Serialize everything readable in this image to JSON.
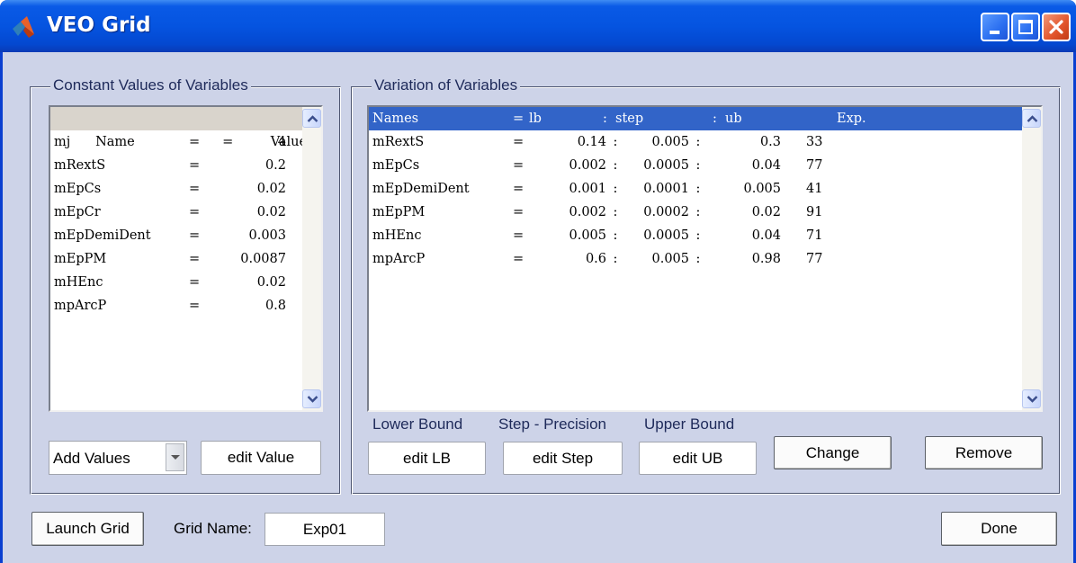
{
  "window": {
    "title": "VEO Grid",
    "buttons": [
      "minimize",
      "maximize",
      "close"
    ]
  },
  "constants_panel": {
    "title": "Constant Values of Variables",
    "header": {
      "name": "Name",
      "eq": "=",
      "value": "Value"
    },
    "rows": [
      {
        "name": "mj",
        "eq": "=",
        "value": "4"
      },
      {
        "name": "mRextS",
        "eq": "=",
        "value": "0.2"
      },
      {
        "name": "mEpCs",
        "eq": "=",
        "value": "0.02"
      },
      {
        "name": "mEpCr",
        "eq": "=",
        "value": "0.02"
      },
      {
        "name": "mEpDemiDent",
        "eq": "=",
        "value": "0.003"
      },
      {
        "name": "mEpPM",
        "eq": "=",
        "value": "0.0087"
      },
      {
        "name": "mHEnc",
        "eq": "=",
        "value": "0.02"
      },
      {
        "name": "mpArcP",
        "eq": "=",
        "value": "0.8"
      }
    ],
    "add_values_select": "Add Values",
    "edit_value_button": "edit Value"
  },
  "variation_panel": {
    "title": "Variation of Variables",
    "header": {
      "names": "Names",
      "eq": "=",
      "lb": "lb",
      "sep1": ":",
      "step": "step",
      "sep2": ":",
      "ub": "ub",
      "exp": "Exp."
    },
    "rows": [
      {
        "names": "mRextS",
        "eq": "=",
        "lb": "0.14",
        "sep1": ":",
        "step": "0.005",
        "sep2": ":",
        "ub": "0.3",
        "exp": "33"
      },
      {
        "names": "mEpCs",
        "eq": "=",
        "lb": "0.002",
        "sep1": ":",
        "step": "0.0005",
        "sep2": ":",
        "ub": "0.04",
        "exp": "77"
      },
      {
        "names": "mEpDemiDent",
        "eq": "=",
        "lb": "0.001",
        "sep1": ":",
        "step": "0.0001",
        "sep2": ":",
        "ub": "0.005",
        "exp": "41"
      },
      {
        "names": "mEpPM",
        "eq": "=",
        "lb": "0.002",
        "sep1": ":",
        "step": "0.0002",
        "sep2": ":",
        "ub": "0.02",
        "exp": "91"
      },
      {
        "names": "mHEnc",
        "eq": "=",
        "lb": "0.005",
        "sep1": ":",
        "step": "0.0005",
        "sep2": ":",
        "ub": "0.04",
        "exp": "71"
      },
      {
        "names": "mpArcP",
        "eq": "=",
        "lb": "0.6",
        "sep1": ":",
        "step": "0.005",
        "sep2": ":",
        "ub": "0.98",
        "exp": "77"
      }
    ],
    "lower_bound_label": "Lower Bound",
    "step_label": "Step - Precision",
    "upper_bound_label": "Upper Bound",
    "edit_lb_button": "edit LB",
    "edit_step_button": "edit Step",
    "edit_ub_button": "edit UB",
    "change_button": "Change",
    "remove_button": "Remove"
  },
  "footer": {
    "launch_button": "Launch Grid",
    "grid_name_label": "Grid Name:",
    "grid_name_value": "Exp01",
    "done_button": "Done"
  },
  "colors": {
    "titlebar": "#0554e0",
    "client_bg": "#cdd3e8",
    "selected_row": "#3264c8",
    "header_row_gray": "#d9d4cc",
    "close_button": "#e2542a"
  }
}
